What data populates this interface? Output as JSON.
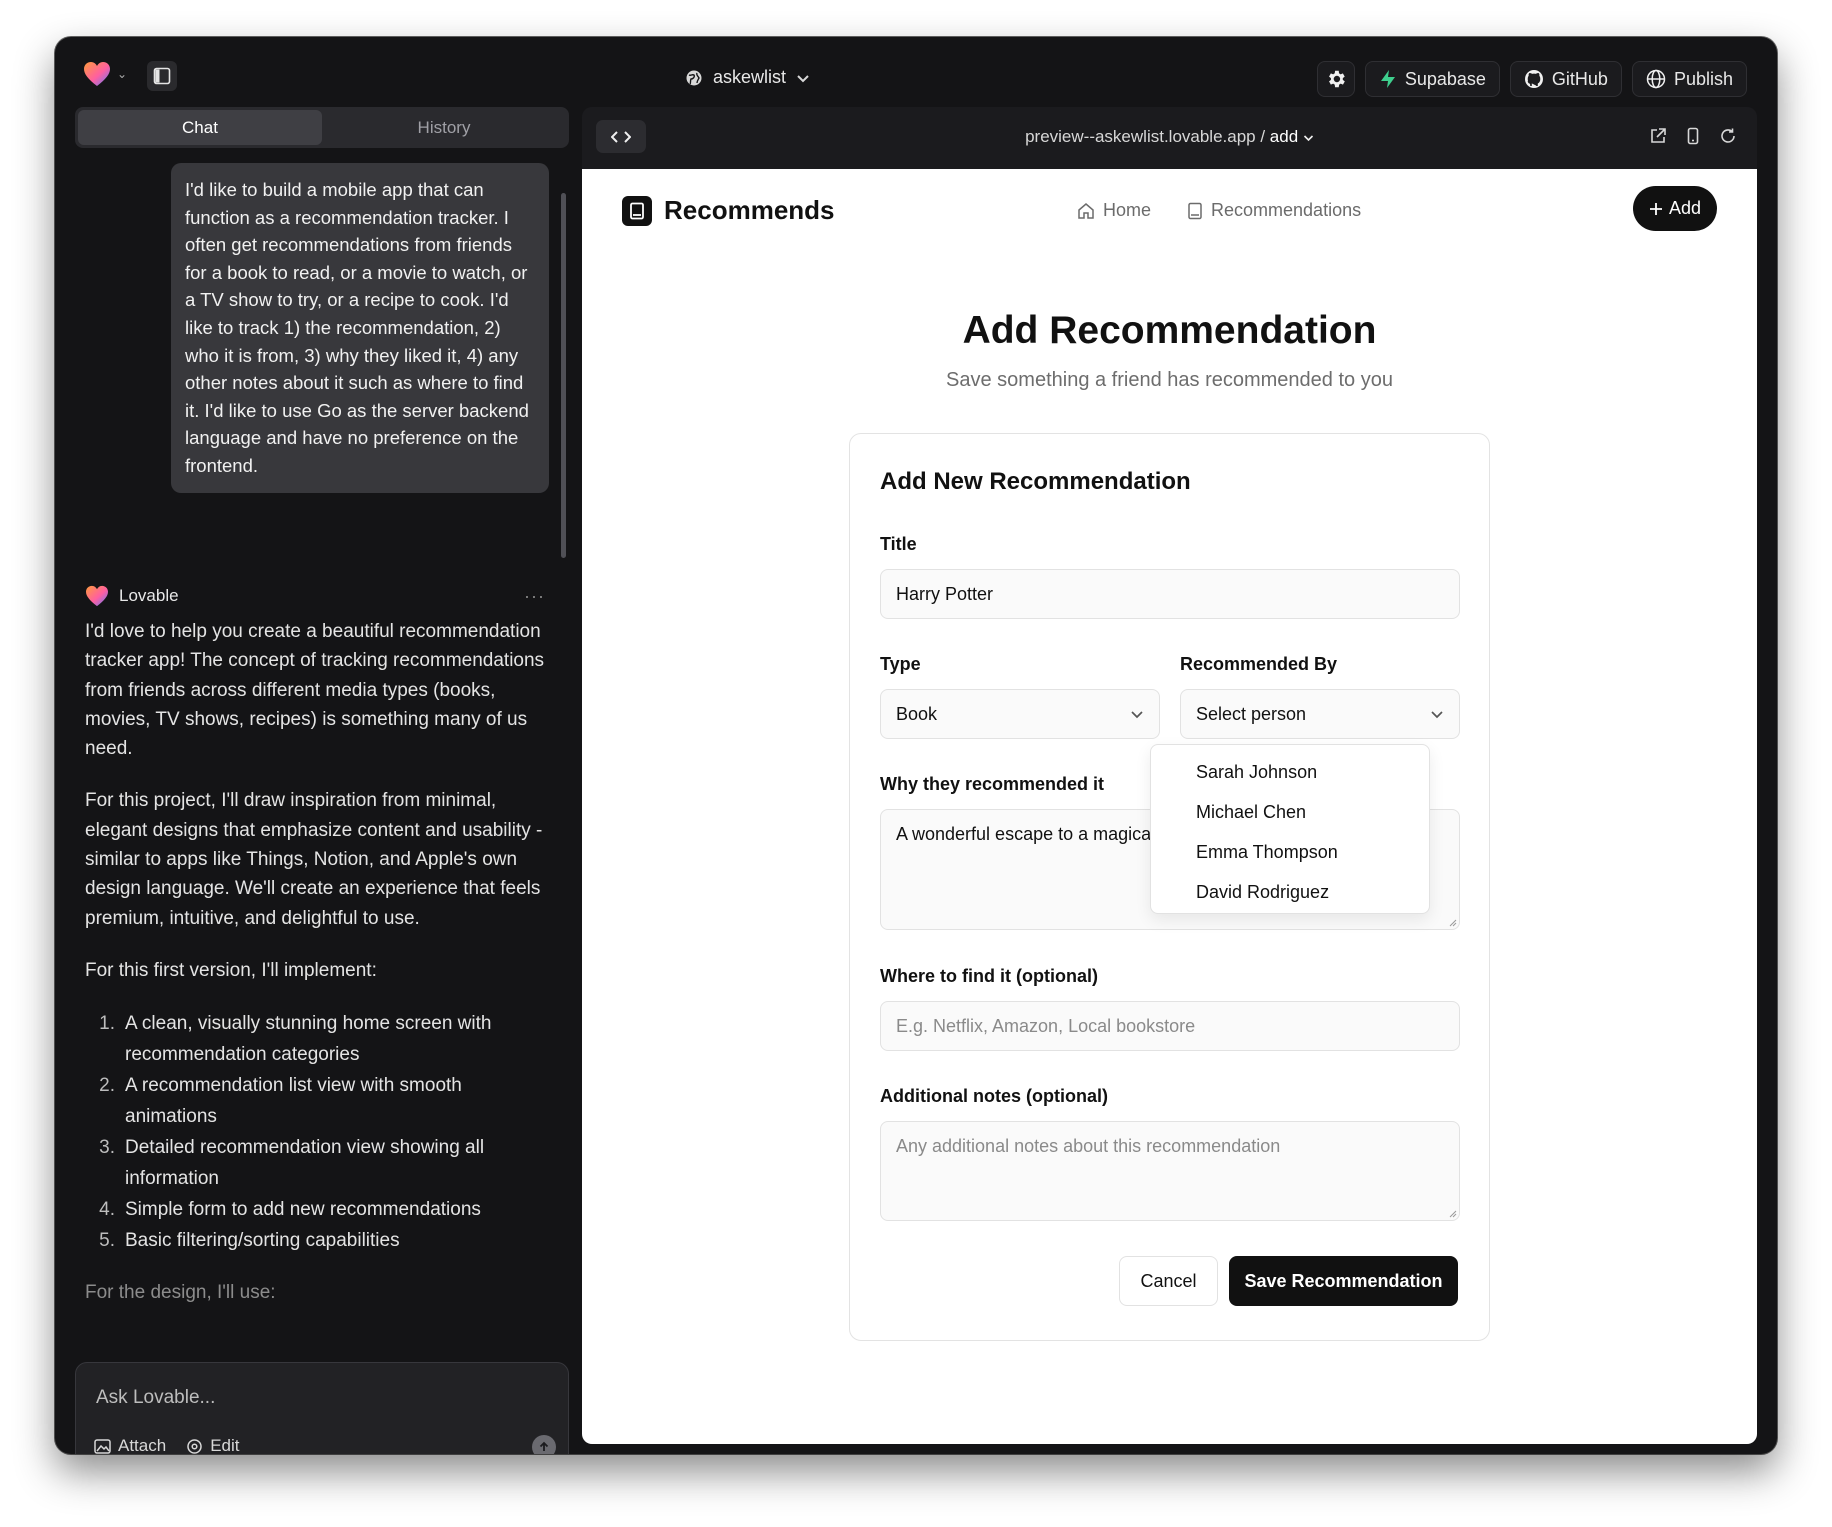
{
  "topbar": {
    "project_name": "askewlist",
    "buttons": {
      "settings_icon": "gear-icon",
      "supabase": "Supabase",
      "github": "GitHub",
      "publish": "Publish"
    }
  },
  "chat": {
    "tabs": [
      {
        "label": "Chat",
        "active": true
      },
      {
        "label": "History",
        "active": false
      }
    ],
    "user_message": "I'd like to build a mobile app that can function as a recommendation tracker. I often get recommendations from friends for a book to read, or a movie to watch, or a TV show to try, or a recipe to cook. I'd like to track 1) the recommendation, 2) who it is from, 3) why they liked it, 4) any other notes about it such as where to find it. I'd like to use Go as the server backend language and have no preference on the frontend.",
    "assistant_name": "Lovable",
    "assistant_menu": "···",
    "paragraphs": [
      "I'd love to help you create a beautiful recommendation tracker app! The concept of tracking recommendations from friends across different media types (books, movies, TV shows, recipes) is something many of us need.",
      "For this project, I'll draw inspiration from minimal, elegant designs that emphasize content and usability - similar to apps like Things, Notion, and Apple's own design language. We'll create an experience that feels premium, intuitive, and delightful to use.",
      "For this first version, I'll implement:"
    ],
    "list": [
      {
        "num": "1.",
        "text": "A clean, visually stunning home screen with recommendation categories"
      },
      {
        "num": "2.",
        "text": "A recommendation list view with smooth animations"
      },
      {
        "num": "3.",
        "text": "Detailed recommendation view showing all information"
      },
      {
        "num": "4.",
        "text": "Simple form to add new recommendations"
      },
      {
        "num": "5.",
        "text": "Basic filtering/sorting capabilities"
      }
    ],
    "trailing": "For the design, I'll use:",
    "composer": {
      "placeholder": "Ask Lovable...",
      "attach": "Attach",
      "edit": "Edit"
    }
  },
  "preview": {
    "url_host": "preview--askewlist.lovable.app",
    "url_sep": " / ",
    "url_path": "add"
  },
  "app": {
    "brand": "Recommends",
    "nav": {
      "home": "Home",
      "recommendations": "Recommendations"
    },
    "add_button": "Add",
    "heading": "Add Recommendation",
    "subheading": "Save something a friend has recommended to you",
    "form": {
      "card_title": "Add New Recommendation",
      "title_label": "Title",
      "title_value": "Harry Potter",
      "type_label": "Type",
      "type_value": "Book",
      "recommended_by_label": "Recommended By",
      "recommended_by_value": "Select person",
      "people_options": [
        "Sarah Johnson",
        "Michael Chen",
        "Emma Thompson",
        "David Rodriguez"
      ],
      "why_label": "Why they recommended it",
      "why_value": "A wonderful escape to a magical wo",
      "where_label": "Where to find it (optional)",
      "where_placeholder": "E.g. Netflix, Amazon, Local bookstore",
      "notes_label": "Additional notes (optional)",
      "notes_placeholder": "Any additional notes about this recommendation",
      "cancel": "Cancel",
      "save": "Save Recommendation"
    }
  }
}
